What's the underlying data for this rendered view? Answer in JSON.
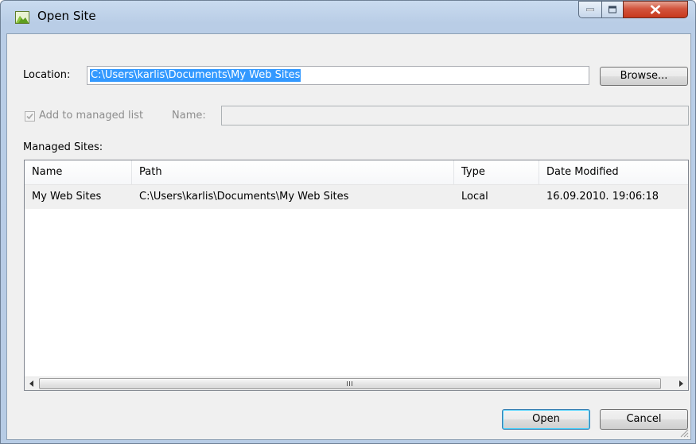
{
  "window": {
    "title": "Open Site",
    "icon": "site-icon",
    "controls": [
      "minimize-icon",
      "maximize-icon",
      "close-icon"
    ]
  },
  "location": {
    "label": "Location:",
    "value": "C:\\Users\\karlis\\Documents\\My Web Sites"
  },
  "browse_label": "Browse...",
  "managed": {
    "checkbox_label": "Add to managed list",
    "checked": true,
    "name_label": "Name:",
    "name_value": ""
  },
  "sites": {
    "label": "Managed Sites:",
    "columns": [
      "Name",
      "Path",
      "Type",
      "Date Modified"
    ],
    "rows": [
      {
        "name": "My Web Sites",
        "path": "C:\\Users\\karlis\\Documents\\My Web Sites",
        "type": "Local",
        "date_modified": "16.09.2010. 19:06:18"
      }
    ]
  },
  "buttons": {
    "open": "Open",
    "cancel": "Cancel"
  },
  "colors": {
    "selection": "#3399ff",
    "frame": "#b9cde6",
    "close_button": "#c8381c"
  }
}
